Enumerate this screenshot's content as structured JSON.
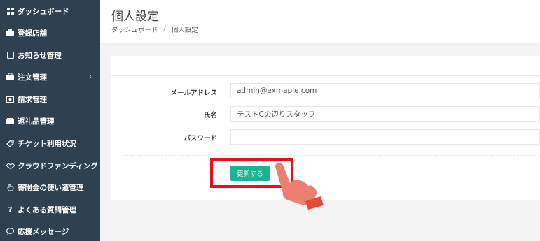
{
  "sidebar": {
    "items": [
      {
        "label": "ダッシュボード",
        "icon": "grid-icon"
      },
      {
        "label": "登録店舗",
        "icon": "store-icon"
      },
      {
        "label": "お知らせ管理",
        "icon": "notice-icon"
      },
      {
        "label": "注文管理",
        "icon": "shop-icon",
        "has_submenu": true
      },
      {
        "label": "請求管理",
        "icon": "money-icon"
      },
      {
        "label": "返礼品管理",
        "icon": "gift-icon"
      },
      {
        "label": "チケット利用状況",
        "icon": "ticket-icon"
      },
      {
        "label": "クラウドファンディング",
        "icon": "handshake-icon"
      },
      {
        "label": "寄附金の使い道管理",
        "icon": "hand-icon"
      },
      {
        "label": "よくある質問管理",
        "icon": "question-icon"
      },
      {
        "label": "応援メッセージ",
        "icon": "chat-icon"
      }
    ],
    "submenu_chevron": "‹"
  },
  "header": {
    "title": "個人設定",
    "breadcrumb": [
      "ダッシュボード",
      "個人設定"
    ],
    "breadcrumb_separator": "/"
  },
  "form": {
    "email_label": "メールアドレス",
    "email_value": "admin@exmaple.com",
    "name_label": "氏名",
    "name_value": "テストCの辺りスタッフ",
    "password_label": "パスワード",
    "password_value": "",
    "submit_label": "更新する"
  },
  "colors": {
    "sidebar_bg": "#2f4050",
    "accent": "#1ab394",
    "highlight": "#e8101c",
    "hand": "#ec7f72",
    "cuff": "#e04a3c"
  }
}
